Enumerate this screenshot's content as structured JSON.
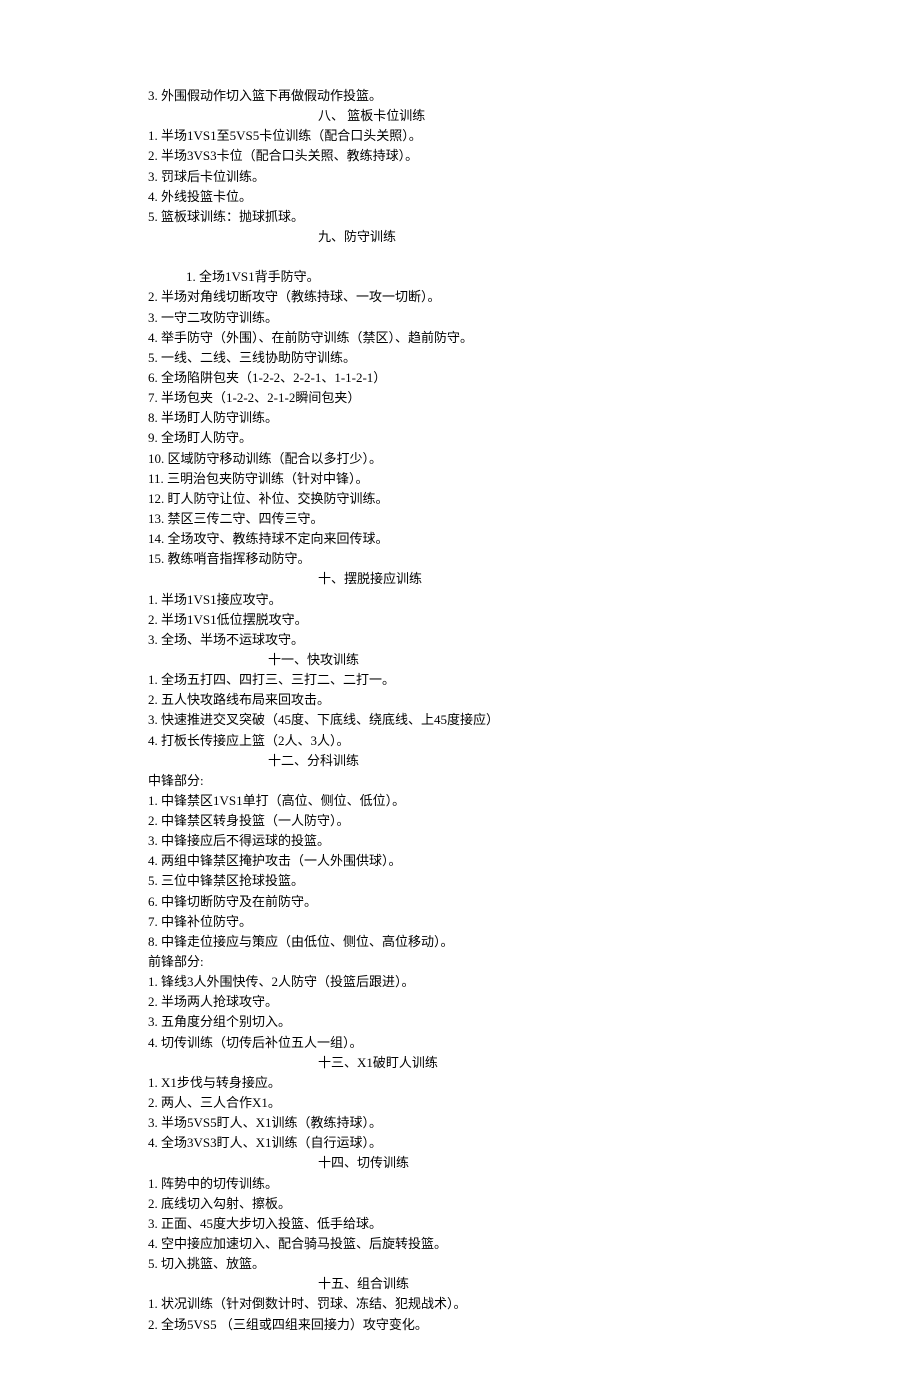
{
  "lines": [
    {
      "cls": "line",
      "key": "l1",
      "text": "3. 外围假动作切入篮下再做假动作投篮。"
    },
    {
      "cls": "line heading",
      "key": "h8",
      "text": "八、 篮板卡位训练"
    },
    {
      "cls": "line",
      "key": "s8_1",
      "text": "1. 半场1VS1至5VS5卡位训练（配合口头关照）。"
    },
    {
      "cls": "line",
      "key": "s8_2",
      "text": "2. 半场3VS3卡位（配合口头关照、教练持球）。"
    },
    {
      "cls": "line",
      "key": "s8_3",
      "text": "3. 罚球后卡位训练。"
    },
    {
      "cls": "line",
      "key": "s8_4",
      "text": "4. 外线投篮卡位。"
    },
    {
      "cls": "line",
      "key": "s8_5",
      "text": "5. 篮板球训练：抛球抓球。"
    },
    {
      "cls": "line heading",
      "key": "h9",
      "text": "九、防守训练"
    },
    {
      "cls": "line",
      "key": "blank1",
      "text": " "
    },
    {
      "cls": "line indent-extra",
      "key": "s9_1",
      "text": "1. 全场1VS1背手防守。"
    },
    {
      "cls": "line",
      "key": "s9_2",
      "text": "2. 半场对角线切断攻守（教练持球、一攻一切断）。"
    },
    {
      "cls": "line",
      "key": "s9_3",
      "text": "3. 一守二攻防守训练。"
    },
    {
      "cls": "line",
      "key": "s9_4",
      "text": "4. 举手防守（外围）、在前防守训练（禁区）、趋前防守。"
    },
    {
      "cls": "line",
      "key": "s9_5",
      "text": "5. 一线、二线、三线协助防守训练。"
    },
    {
      "cls": "line",
      "key": "s9_6",
      "text": "6. 全场陷阱包夹（1-2-2、2-2-1、1-1-2-1）"
    },
    {
      "cls": "line",
      "key": "s9_7",
      "text": "7. 半场包夹（1-2-2、2-1-2瞬间包夹）"
    },
    {
      "cls": "line",
      "key": "s9_8",
      "text": "8. 半场盯人防守训练。"
    },
    {
      "cls": "line",
      "key": "s9_9",
      "text": "9. 全场盯人防守。"
    },
    {
      "cls": "line",
      "key": "s9_10",
      "text": "10. 区域防守移动训练（配合以多打少）。"
    },
    {
      "cls": "line",
      "key": "s9_11",
      "text": "11. 三明治包夹防守训练（针对中锋）。"
    },
    {
      "cls": "line",
      "key": "s9_12",
      "text": "12. 盯人防守让位、补位、交换防守训练。"
    },
    {
      "cls": "line",
      "key": "s9_13",
      "text": "13. 禁区三传二守、四传三守。"
    },
    {
      "cls": "line",
      "key": "s9_14",
      "text": "14. 全场攻守、教练持球不定向来回传球。"
    },
    {
      "cls": "line",
      "key": "s9_15",
      "text": "15. 教练哨音指挥移动防守。"
    },
    {
      "cls": "line heading",
      "key": "h10",
      "text": "十、摆脱接应训练"
    },
    {
      "cls": "line",
      "key": "s10_1",
      "text": "1. 半场1VS1接应攻守。"
    },
    {
      "cls": "line",
      "key": "s10_2",
      "text": "2. 半场1VS1低位摆脱攻守。"
    },
    {
      "cls": "line",
      "key": "s10_3",
      "text": "3. 全场、半场不运球攻守。"
    },
    {
      "cls": "line heading-narrow",
      "key": "h11",
      "text": "十一、快攻训练"
    },
    {
      "cls": "line",
      "key": "s11_1",
      "text": "1. 全场五打四、四打三、三打二、二打一。"
    },
    {
      "cls": "line",
      "key": "s11_2",
      "text": "2. 五人快攻路线布局来回攻击。"
    },
    {
      "cls": "line",
      "key": "s11_3",
      "text": "3. 快速推进交叉突破（45度、下底线、绕底线、上45度接应）"
    },
    {
      "cls": "line",
      "key": "s11_4",
      "text": "4. 打板长传接应上篮（2人、3人）。"
    },
    {
      "cls": "line heading-narrow",
      "key": "h12",
      "text": "十二、分科训练"
    },
    {
      "cls": "line",
      "key": "zc",
      "text": "中锋部分:"
    },
    {
      "cls": "line",
      "key": "zc1",
      "text": "1. 中锋禁区1VS1单打（高位、侧位、低位）。"
    },
    {
      "cls": "line",
      "key": "zc2",
      "text": "2. 中锋禁区转身投篮（一人防守）。"
    },
    {
      "cls": "line",
      "key": "zc3",
      "text": "3. 中锋接应后不得运球的投篮。"
    },
    {
      "cls": "line",
      "key": "zc4",
      "text": "4. 两组中锋禁区掩护攻击（一人外围供球）。"
    },
    {
      "cls": "line",
      "key": "zc5",
      "text": "5. 三位中锋禁区抢球投篮。"
    },
    {
      "cls": "line",
      "key": "zc6",
      "text": "6. 中锋切断防守及在前防守。"
    },
    {
      "cls": "line",
      "key": "zc7",
      "text": "7. 中锋补位防守。"
    },
    {
      "cls": "line",
      "key": "zc8",
      "text": "8. 中锋走位接应与策应（由低位、侧位、高位移动）。"
    },
    {
      "cls": "line",
      "key": "qf",
      "text": "前锋部分:"
    },
    {
      "cls": "line",
      "key": "qf1",
      "text": "1. 锋线3人外围快传、2人防守（投篮后跟进）。"
    },
    {
      "cls": "line",
      "key": "qf2",
      "text": "2. 半场两人抢球攻守。"
    },
    {
      "cls": "line",
      "key": "qf3",
      "text": "3. 五角度分组个别切入。"
    },
    {
      "cls": "line",
      "key": "qf4",
      "text": "4. 切传训练（切传后补位五人一组）。"
    },
    {
      "cls": "line heading",
      "key": "h13",
      "text": "十三、X1破盯人训练"
    },
    {
      "cls": "line",
      "key": "s13_1",
      "text": "1. X1步伐与转身接应。"
    },
    {
      "cls": "line",
      "key": "s13_2",
      "text": "2. 两人、三人合作X1。"
    },
    {
      "cls": "line",
      "key": "s13_3",
      "text": "3. 半场5VS5盯人、X1训练（教练持球）。"
    },
    {
      "cls": "line",
      "key": "s13_4",
      "text": "4. 全场3VS3盯人、X1训练（自行运球）。"
    },
    {
      "cls": "line heading",
      "key": "h14",
      "text": "十四、切传训练"
    },
    {
      "cls": "line",
      "key": "s14_1",
      "text": "1. 阵势中的切传训练。"
    },
    {
      "cls": "line",
      "key": "s14_2",
      "text": "2. 底线切入勾射、擦板。"
    },
    {
      "cls": "line",
      "key": "s14_3",
      "text": "3. 正面、45度大步切入投篮、低手给球。"
    },
    {
      "cls": "line",
      "key": "s14_4",
      "text": "4. 空中接应加速切入、配合骑马投篮、后旋转投篮。"
    },
    {
      "cls": "line",
      "key": "s14_5",
      "text": "5. 切入挑篮、放篮。"
    },
    {
      "cls": "line heading",
      "key": "h15",
      "text": "十五、组合训练"
    },
    {
      "cls": "line",
      "key": "s15_1",
      "text": "1. 状况训练（针对倒数计时、罚球、冻结、犯规战术）。"
    },
    {
      "cls": "line",
      "key": "s15_2",
      "text": "2. 全场5VS5 （三组或四组来回接力）攻守变化。"
    }
  ]
}
